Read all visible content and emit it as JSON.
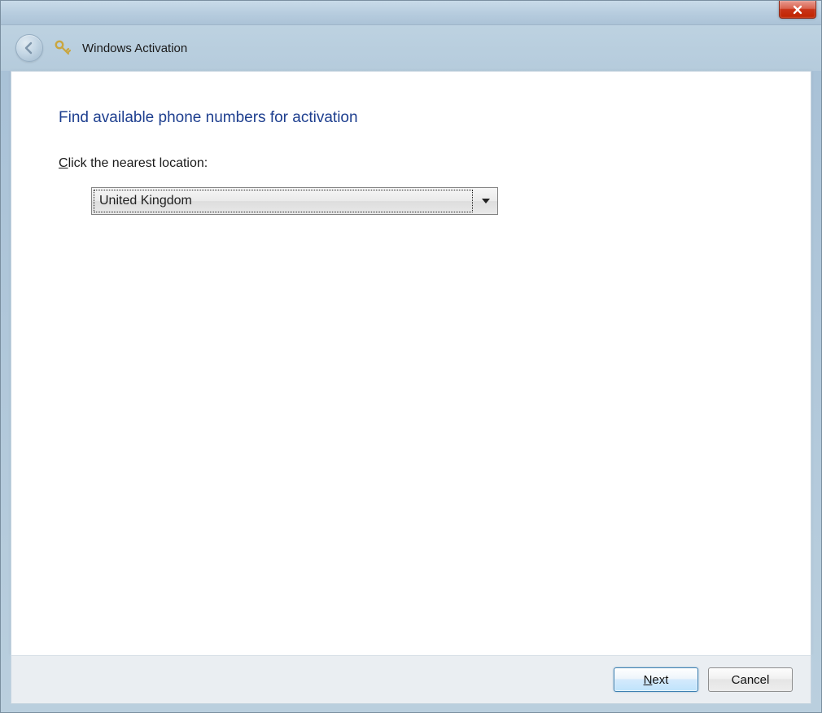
{
  "window": {
    "app_title": "Windows Activation"
  },
  "page": {
    "heading": "Find available phone numbers for activation",
    "label_prefix": "C",
    "label_rest": "lick the nearest location:",
    "dropdown_value": "United Kingdom"
  },
  "footer": {
    "next_prefix": "N",
    "next_rest": "ext",
    "cancel": "Cancel"
  }
}
